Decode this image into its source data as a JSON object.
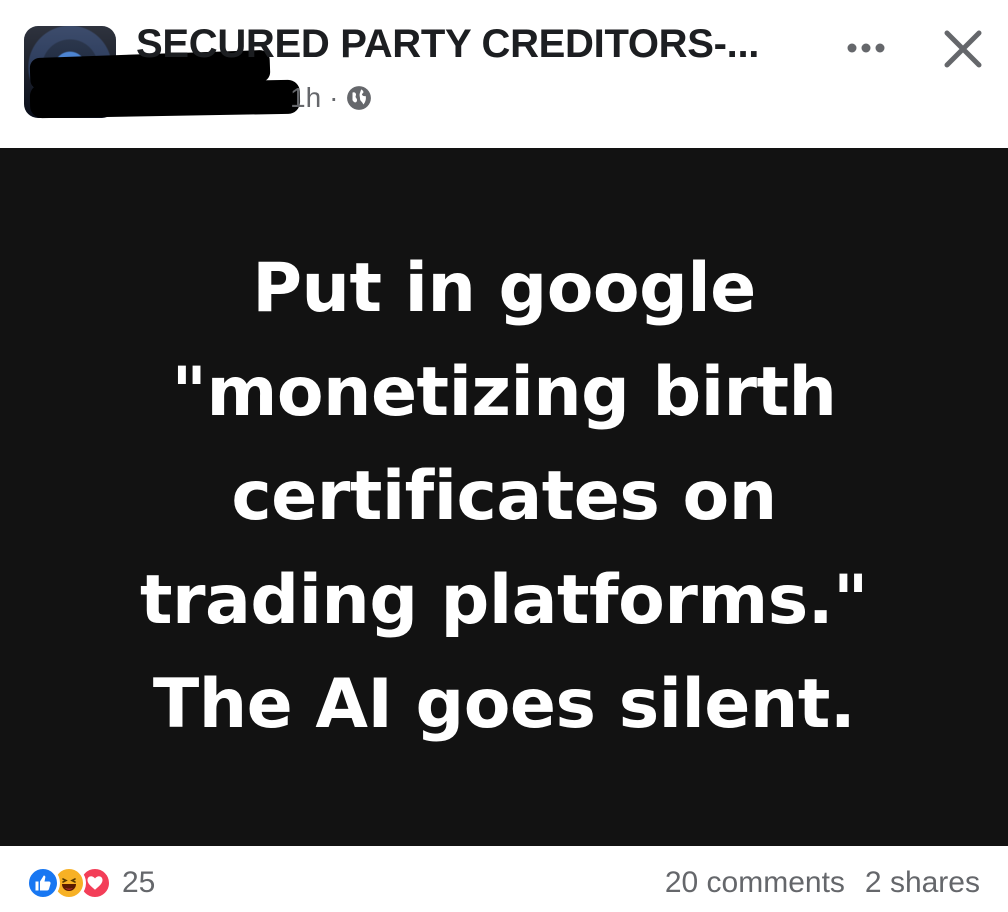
{
  "header": {
    "group_name": "SECURED PARTY CREDITORS-...",
    "time_ago": "1h",
    "separator": "·",
    "audience_icon": "globe-icon",
    "more_icon": "more-horizontal-icon",
    "close_icon": "close-icon"
  },
  "post_image": {
    "lines": [
      "Put in google",
      "\"monetizing birth",
      "certificates on",
      "trading platforms.\"",
      "The AI goes silent."
    ],
    "background_color": "#121212",
    "text_color": "#ffffff"
  },
  "footer": {
    "reaction_icons": [
      "like-icon",
      "haha-icon",
      "love-icon"
    ],
    "reaction_count": "25",
    "comments": "20 comments",
    "shares": "2 shares"
  },
  "colors": {
    "like": "#1877f2",
    "haha": "#f7b125",
    "love": "#f33e58",
    "secondary_text": "#65676b",
    "primary_text": "#1c1e21"
  }
}
